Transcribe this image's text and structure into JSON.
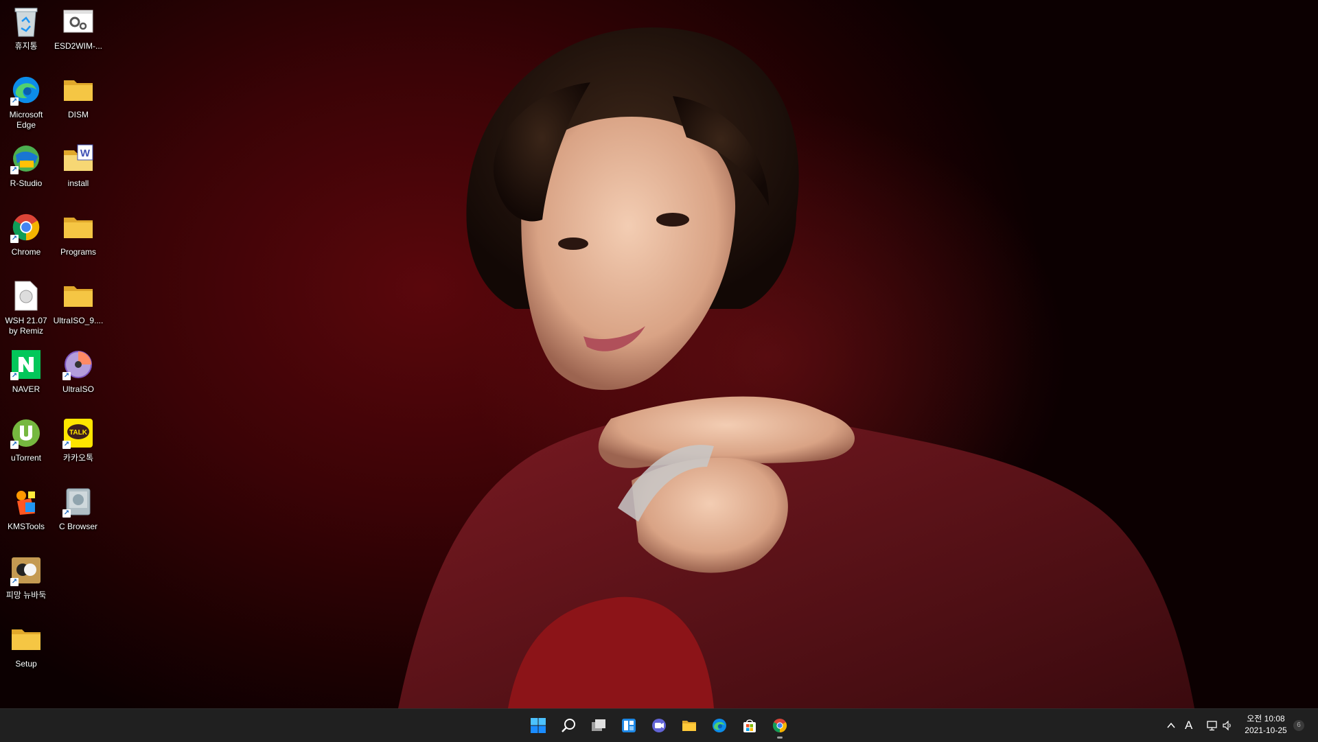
{
  "desktop": {
    "icons": [
      {
        "label": "휴지통",
        "icon": "recycle-bin-icon"
      },
      {
        "label": "ESD2WIM-...",
        "icon": "settings-app-icon"
      },
      {
        "label": "Microsoft Edge",
        "icon": "edge-icon"
      },
      {
        "label": "DISM",
        "icon": "folder-icon"
      },
      {
        "label": "R-Studio",
        "icon": "r-studio-icon"
      },
      {
        "label": "install",
        "icon": "folder-word-icon"
      },
      {
        "label": "Chrome",
        "icon": "chrome-icon"
      },
      {
        "label": "Programs",
        "icon": "folder-icon"
      },
      {
        "label": "WSH 21.07 by Remiz",
        "icon": "file-icon"
      },
      {
        "label": "UltraISO_9....",
        "icon": "folder-icon"
      },
      {
        "label": "NAVER",
        "icon": "naver-icon"
      },
      {
        "label": "UltraISO",
        "icon": "ultraiso-icon"
      },
      {
        "label": "uTorrent",
        "icon": "utorrent-icon"
      },
      {
        "label": "카카오톡",
        "icon": "kakaotalk-icon"
      },
      {
        "label": "KMSTools",
        "icon": "kmstools-icon"
      },
      {
        "label": "C Browser",
        "icon": "c-browser-icon"
      },
      {
        "label": "피망 뉴바둑",
        "icon": "pmang-baduk-icon"
      },
      {
        "label": "Setup",
        "icon": "folder-icon"
      }
    ]
  },
  "taskbar": {
    "apps": [
      "start-icon",
      "search-icon",
      "task-view-icon",
      "widgets-icon",
      "chat-icon",
      "file-explorer-icon",
      "edge-icon",
      "store-icon",
      "chrome-icon"
    ],
    "tray": {
      "ime": "A",
      "time": "오전 10:08",
      "date": "2021-10-25",
      "notifications": "6"
    }
  },
  "colors": {
    "taskbar": "#202020",
    "wallpaper_dark": "#3b0306",
    "folder": "#f5c644",
    "accent": "#0078d4"
  }
}
